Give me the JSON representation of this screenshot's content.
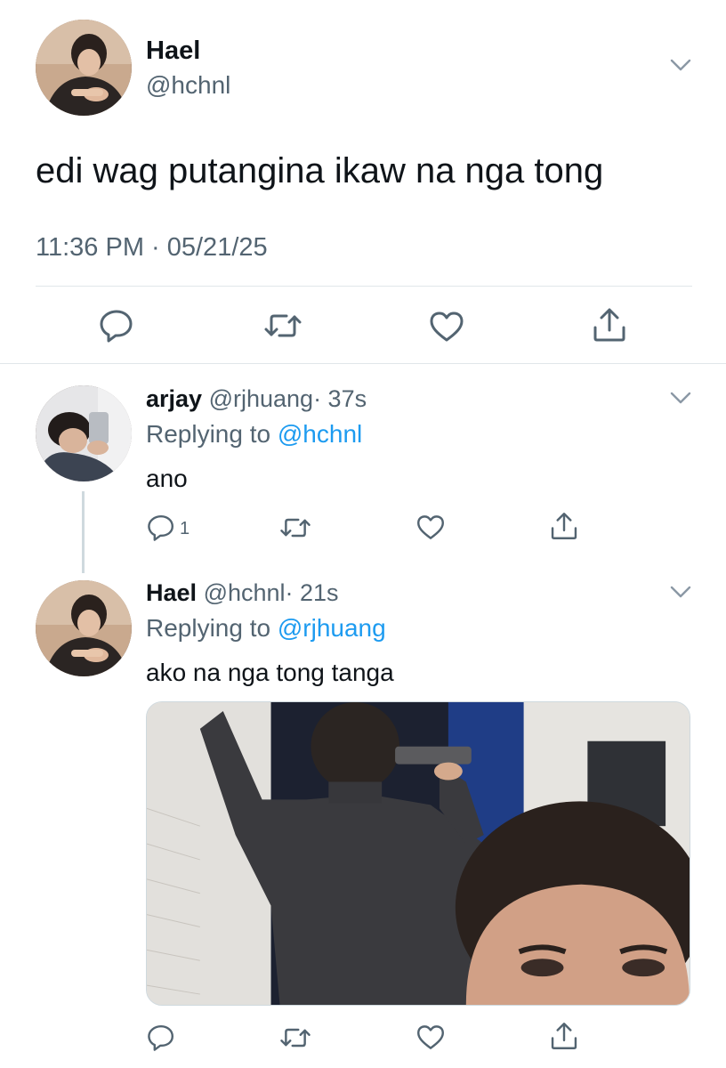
{
  "main_tweet": {
    "display_name": "Hael",
    "handle": "@hchnl",
    "text": "edi wag putangina ikaw na nga tong",
    "timestamp": "11:36 PM · 05/21/25",
    "avatar_icon": "profile-avatar",
    "actions": [
      "reply-icon",
      "retweet-icon",
      "like-icon",
      "share-icon"
    ]
  },
  "replies": [
    {
      "display_name": "arjay",
      "handle": "@rjhuang",
      "age": "· 37s",
      "replying_prefix": "Replying to",
      "replying_to": "@hchnl",
      "text": "ano",
      "reply_count": "1"
    },
    {
      "display_name": "Hael",
      "handle": "@hchnl",
      "age": "· 21s",
      "replying_prefix": "Replying to",
      "replying_to": "@rjhuang",
      "text": "ako na nga tong tanga",
      "media_description": "photo"
    }
  ],
  "colors": {
    "text": "#0f1419",
    "secondary": "#536471",
    "link": "#1d9bf0",
    "divider": "#e1e6ea"
  }
}
